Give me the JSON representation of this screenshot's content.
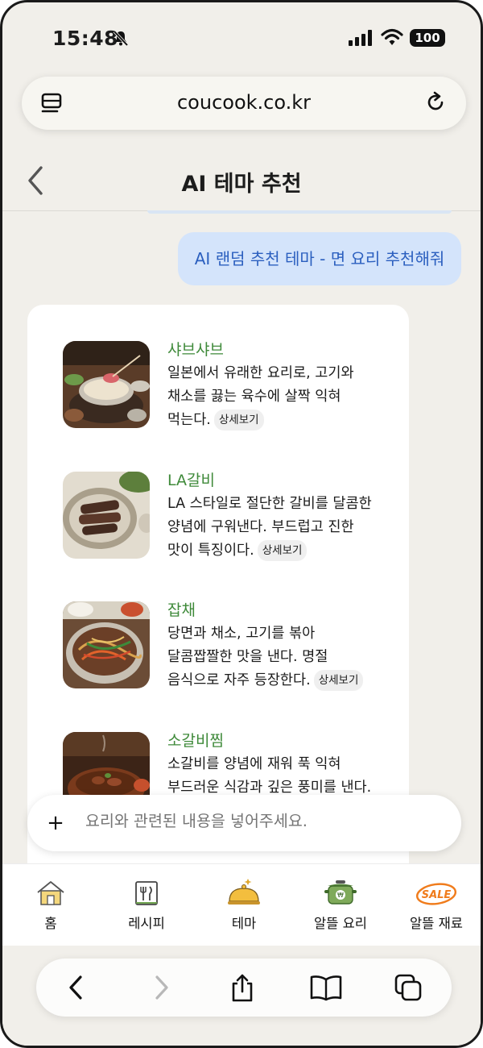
{
  "status": {
    "time": "15:48",
    "battery": "100"
  },
  "browser": {
    "url": "coucook.co.kr"
  },
  "header": {
    "title": "AI 테마 추천"
  },
  "chat": {
    "user_message": "AI 랜덤 추천 테마 - 면 요리 추천해줘",
    "detail_label": "상세보기",
    "results": [
      {
        "name": "샤브샤브",
        "desc": "일본에서 유래한 요리로, 고기와 채소를 끓는 육수에 살짝 익혀 먹는다."
      },
      {
        "name": "LA갈비",
        "desc": "LA 스타일로 절단한 갈비를 달콤한 양념에 구워낸다. 부드럽고 진한 맛이 특징이다."
      },
      {
        "name": "잡채",
        "desc": "당면과 채소, 고기를 볶아 달콤짭짤한 맛을 낸다. 명절 음식으로 자주 등장한다."
      },
      {
        "name": "소갈비찜",
        "desc": "소갈비를 양념에 재워 푹 익혀 부드러운 식감과 깊은 풍미를 낸다."
      }
    ],
    "input_placeholder": "요리와 관련된 내용을 넣어주세요."
  },
  "nav": {
    "home": "홈",
    "recipe": "레시피",
    "theme": "테마",
    "budget_cooking": "알뜰 요리",
    "budget_ingredients": "알뜰 재료",
    "sale_badge": "SALE"
  },
  "colors": {
    "accent_green": "#3f8a3a",
    "bubble_blue": "#d4e4fb",
    "bubble_text": "#2b5fbf",
    "sale_orange": "#f07c1c"
  }
}
